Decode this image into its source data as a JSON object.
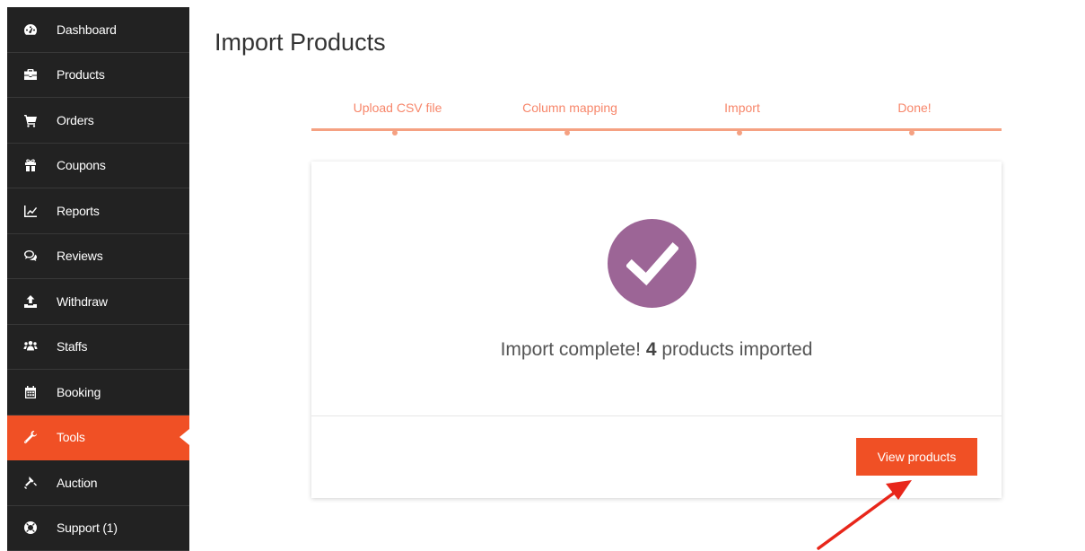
{
  "sidebar": {
    "items": [
      {
        "label": "Dashboard",
        "icon": "dashboard-icon"
      },
      {
        "label": "Products",
        "icon": "briefcase-icon"
      },
      {
        "label": "Orders",
        "icon": "cart-icon"
      },
      {
        "label": "Coupons",
        "icon": "gift-icon"
      },
      {
        "label": "Reports",
        "icon": "line-chart-icon"
      },
      {
        "label": "Reviews",
        "icon": "comments-icon"
      },
      {
        "label": "Withdraw",
        "icon": "upload-icon"
      },
      {
        "label": "Staffs",
        "icon": "users-icon"
      },
      {
        "label": "Booking",
        "icon": "calendar-icon"
      },
      {
        "label": "Tools",
        "icon": "wrench-icon",
        "active": true
      },
      {
        "label": "Auction",
        "icon": "gavel-icon"
      },
      {
        "label": "Support (1)",
        "icon": "life-ring-icon"
      }
    ]
  },
  "page": {
    "title": "Import Products"
  },
  "stepper": {
    "steps": [
      "Upload CSV file",
      "Column mapping",
      "Import",
      "Done!"
    ]
  },
  "result": {
    "prefix": "Import complete! ",
    "count": "4",
    "suffix": " products imported",
    "icon": "checkmark-icon"
  },
  "actions": {
    "view_products_label": "View products"
  },
  "colors": {
    "sidebar_bg": "#222222",
    "accent": "#f05025",
    "step_color": "#f7866a",
    "check_circle": "#9c6596",
    "arrow": "#e8261a"
  }
}
